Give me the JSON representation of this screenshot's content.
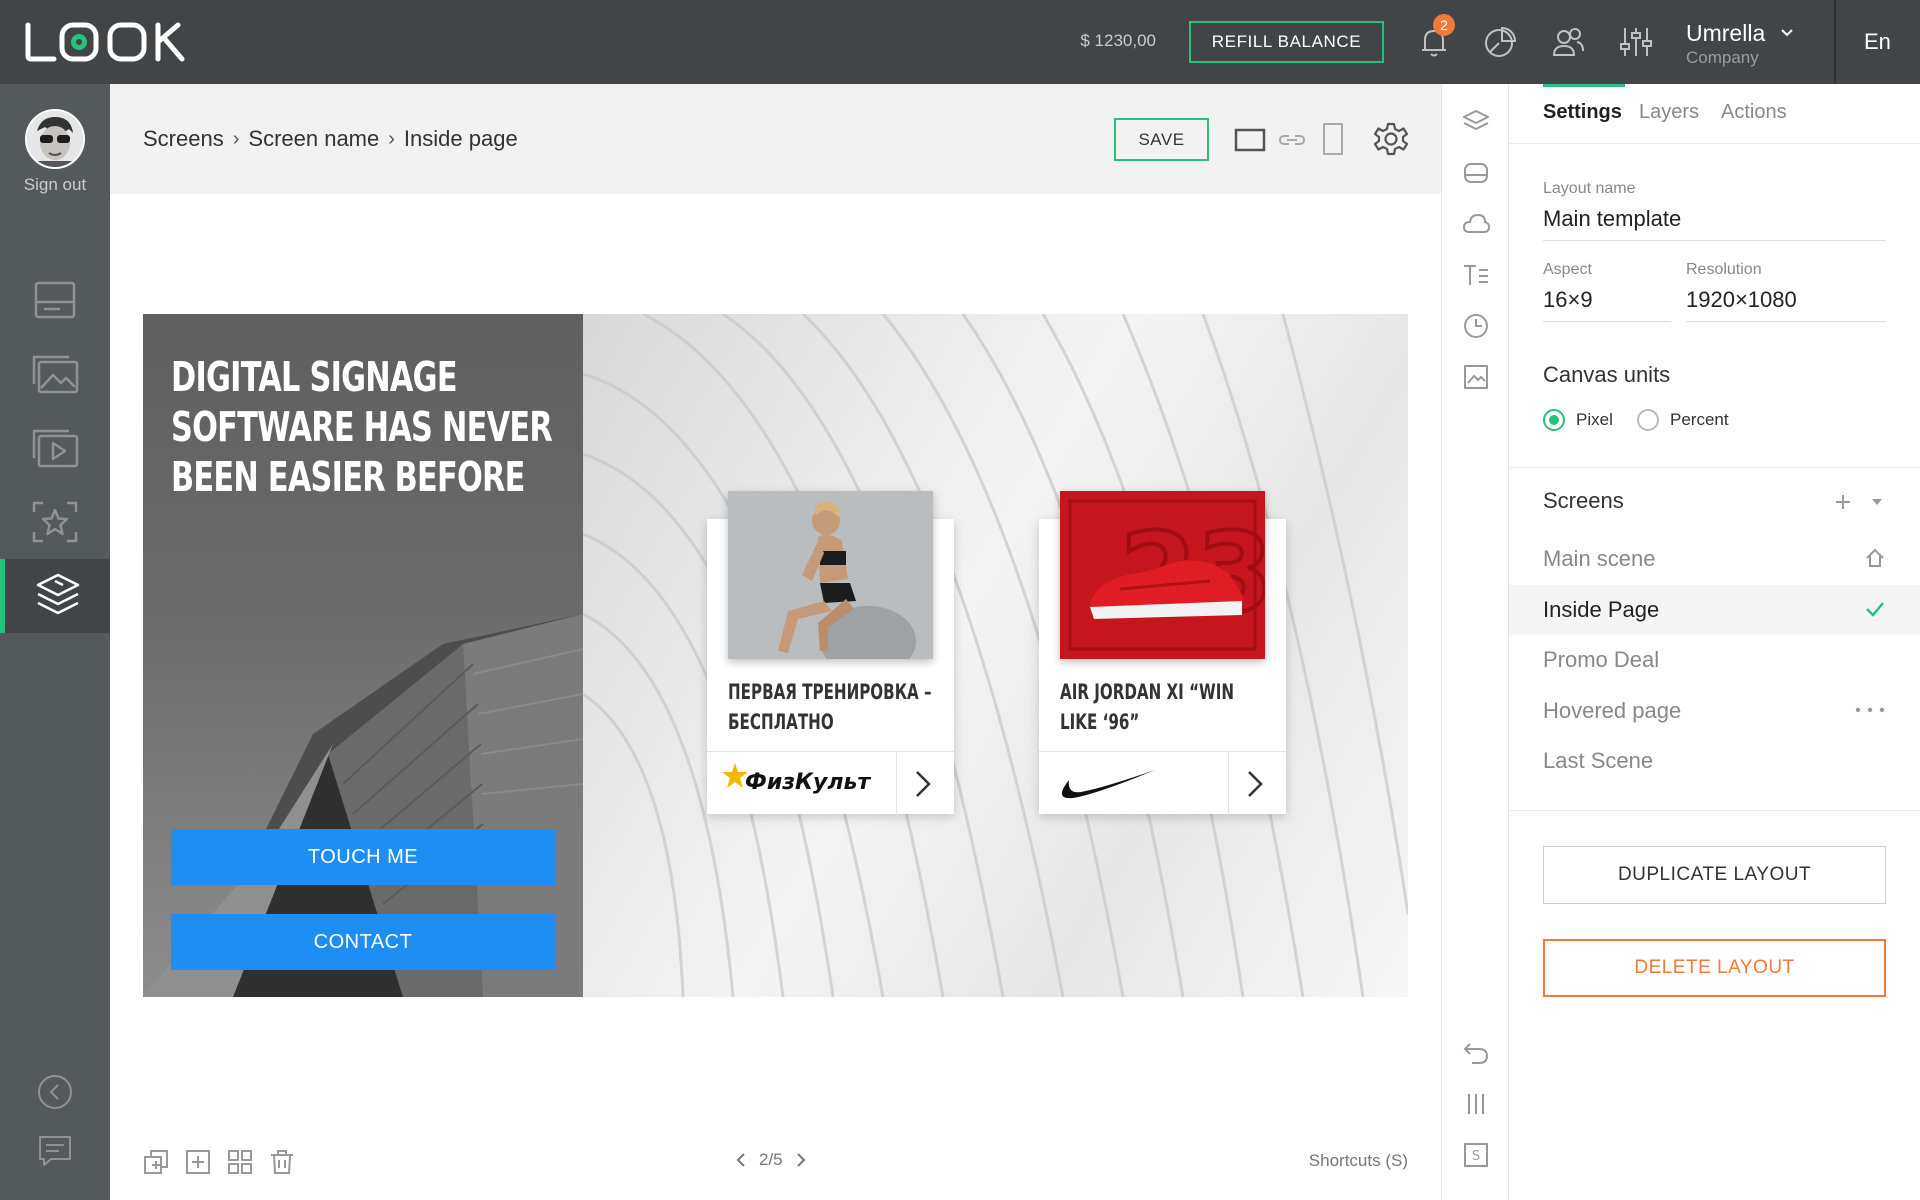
{
  "app": {
    "logo_text": "LOOK"
  },
  "topbar": {
    "balance": "$ 1230,00",
    "refill_label": "REFILL BALANCE",
    "notification_count": "2",
    "company_name": "Umrella",
    "company_sub": "Company",
    "language": "En",
    "accent_color": "#27c27a"
  },
  "sidebar": {
    "sign_out": "Sign out",
    "items": [
      {
        "icon": "screens-icon"
      },
      {
        "icon": "gallery-icon"
      },
      {
        "icon": "video-icon"
      },
      {
        "icon": "favorites-icon"
      },
      {
        "icon": "layers-icon",
        "active": true
      }
    ]
  },
  "header": {
    "breadcrumb": [
      "Screens",
      "Screen name",
      "Inside page"
    ],
    "save_label": "SAVE"
  },
  "canvas": {
    "headline": [
      "DIGITAL SIGNAGE",
      "SOFTWARE HAS NEVER",
      "BEEN EASIER BEFORE"
    ],
    "touch_label": "TOUCH ME",
    "contact_label": "CONTACT",
    "cards": [
      {
        "title": [
          "ПЕРВАЯ ТРЕНИРОВКА –",
          "БЕСПЛАТНО"
        ],
        "brand": "ФизКульт"
      },
      {
        "title": [
          "AIR JORDAN XI “WIN",
          "LIKE ‘96”"
        ],
        "brand": "nike-logo"
      }
    ]
  },
  "footer": {
    "pager": "2/5",
    "shortcuts": "Shortcuts (S)"
  },
  "panel": {
    "tabs": [
      "Settings",
      "Layers",
      "Actions"
    ],
    "layout_name_label": "Layout name",
    "layout_name": "Main template",
    "aspect_label": "Aspect",
    "aspect": "16×9",
    "resolution_label": "Resolution",
    "resolution": "1920×1080",
    "canvas_units_title": "Canvas units",
    "unit_pixel": "Pixel",
    "unit_percent": "Percent",
    "selected_unit": "Pixel",
    "screens_title": "Screens",
    "screens": [
      "Main scene",
      "Inside Page",
      "Promo Deal",
      "Hovered page",
      "Last Scene"
    ],
    "selected_screen": "Inside Page",
    "duplicate_label": "DUPLICATE LAYOUT",
    "delete_label": "DELETE LAYOUT",
    "delete_color": "#f07a3a"
  }
}
